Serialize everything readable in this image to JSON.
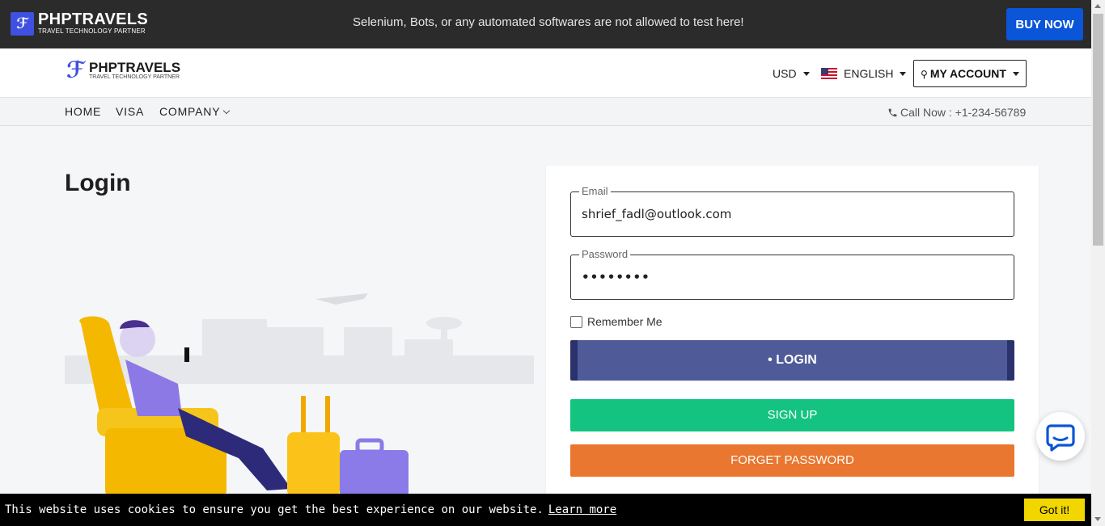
{
  "topbar": {
    "brand": "PHPTRAVELS",
    "brand_sub": "TRAVEL TECHNOLOGY PARTNER",
    "notice": "Selenium, Bots, or any automated softwares are not allowed to test here!",
    "buy_now": "BUY NOW"
  },
  "header": {
    "brand": "PHPTRAVELS",
    "brand_sub": "TRAVEL TECHNOLOGY PARTNER",
    "currency": "USD",
    "language": "ENGLISH",
    "account": "MY ACCOUNT"
  },
  "nav": {
    "items": [
      "HOME",
      "VISA",
      "COMPANY"
    ],
    "call": "Call Now : +1-234-56789"
  },
  "login": {
    "title": "Login",
    "email_label": "Email",
    "email_value": "shrief_fadl@outlook.com",
    "password_label": "Password",
    "password_value": "••••••••",
    "remember": "Remember Me",
    "login_button": "• LOGIN",
    "signup_button": "SIGN UP",
    "forget_button": "FORGET PASSWORD"
  },
  "cookie": {
    "message": "This website uses cookies to ensure you get the best experience on our website.",
    "learn_more": "Learn more",
    "accept": "Got it!"
  },
  "colors": {
    "buy_now": "#0a55d8",
    "login_button": "#4f5a99",
    "signup_button": "#14c37f",
    "forget_button": "#e9772f",
    "cookie_accept": "#f1d600"
  }
}
